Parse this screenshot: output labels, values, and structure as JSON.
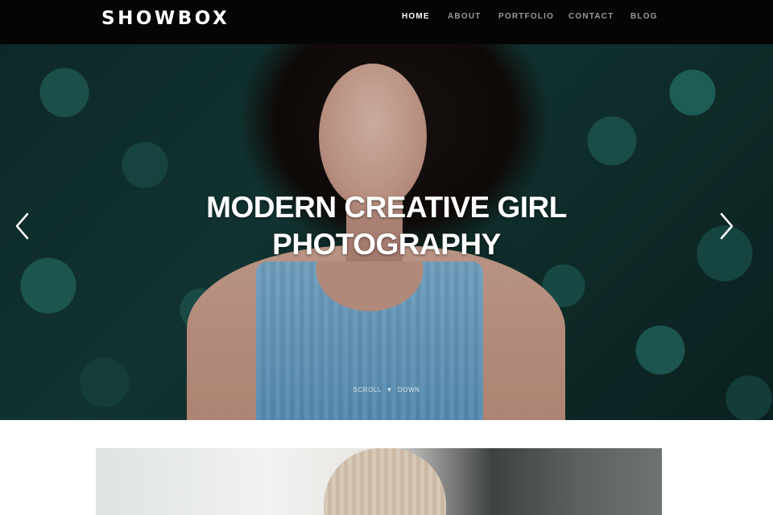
{
  "brand": {
    "logo_text": "SHOWBOX"
  },
  "nav": {
    "items": [
      {
        "label": "HOME",
        "active": true
      },
      {
        "label": "ABOUT",
        "active": false
      },
      {
        "label": "PORTFOLIO",
        "active": false
      },
      {
        "label": "CONTACT",
        "active": false
      },
      {
        "label": "BLOG",
        "active": false
      }
    ]
  },
  "hero": {
    "title_line1": "MODERN CREATIVE GIRL",
    "title_line2": "PHOTOGRAPHY",
    "scroll_left": "SCROLL",
    "scroll_right": "DOWN",
    "scroll_icon": "▼",
    "prev_icon": "chevron-left-icon",
    "next_icon": "chevron-right-icon"
  },
  "colors": {
    "nav_background": "#050505",
    "nav_active": "#ffffff",
    "nav_inactive": "#9a9a9a",
    "hero_text": "#ffffff"
  }
}
